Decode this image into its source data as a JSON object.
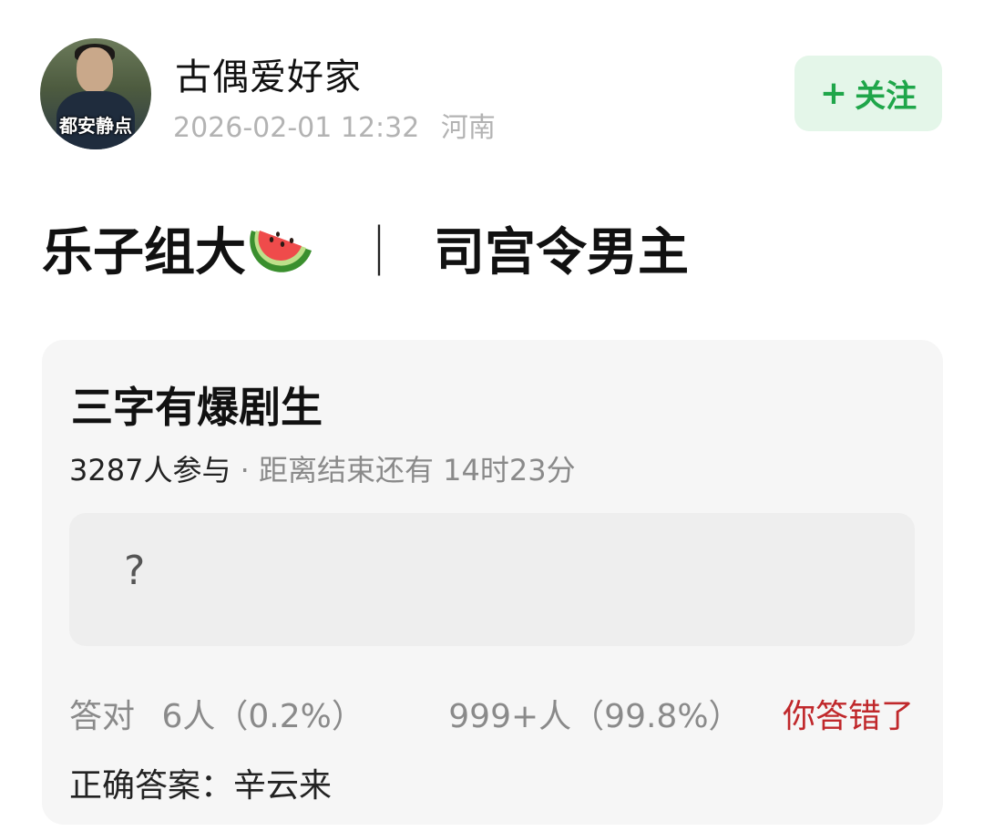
{
  "post": {
    "username": "古偶爱好家",
    "avatar_badge": "都安静点",
    "datetime": "2026-02-01 12:32",
    "location": "河南",
    "follow_label": "关注",
    "follow_icon": "plus-icon",
    "title_left": "乐子组大",
    "title_emoji": "watermelon-icon",
    "title_separator": "｜",
    "title_right": "司宫令男主"
  },
  "quiz": {
    "question_title": "三字有爆剧生",
    "participants": "3287人参与",
    "time_left": "· 距离结束还有 14时23分",
    "answer_placeholder": "?",
    "correct_label": "答对",
    "correct_count": "6人（0.2%）",
    "wrong_count": "999+人（99.8%）",
    "wrong_label": "你答错了",
    "correct_answer": "正确答案：辛云来"
  },
  "colors": {
    "follow_bg": "#e4f6e9",
    "follow_text": "#1fa64a",
    "wrong_text": "#c0282b",
    "card_bg": "#f6f6f6"
  }
}
